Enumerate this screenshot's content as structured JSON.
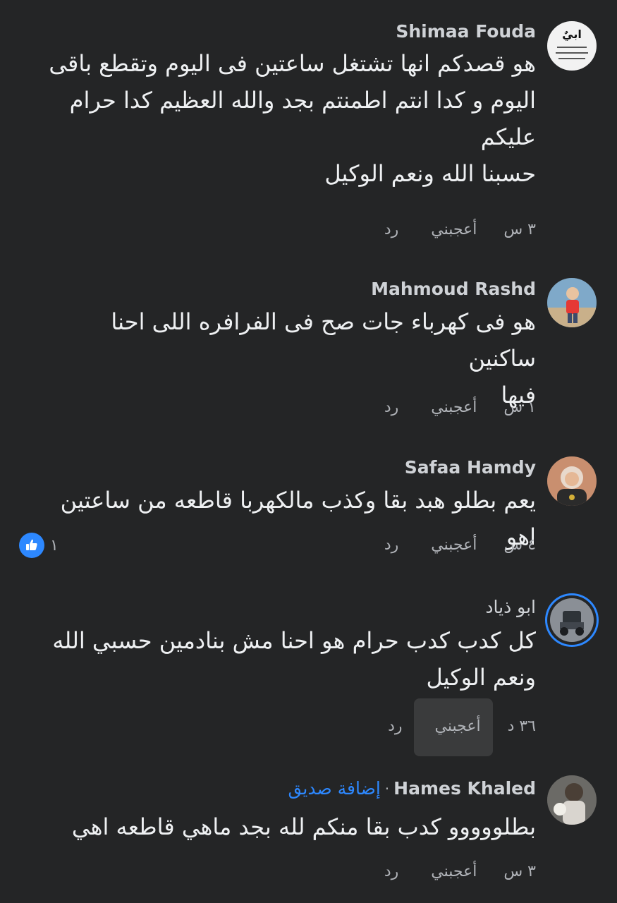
{
  "comments": [
    {
      "author": "Shimaa Fouda",
      "avatar_text": "ابيٌ",
      "lines": [
        "هو قصدكم انها تشتغل ساعتين فى اليوم وتقطع باقى",
        "اليوم و كدا انتم اطمنتم بجد والله العظيم كدا حرام",
        "عليكم",
        "حسبنا الله ونعم الوكيل"
      ],
      "time": "٣ س",
      "like": "أعجبني",
      "reply": "رد"
    },
    {
      "author": "Mahmoud Rashd",
      "lines": [
        "هو فى كهرباء جات صح فى الفرافره اللى احنا ساكنين",
        "فيها"
      ],
      "time": "١ س",
      "like": "أعجبني",
      "reply": "رد"
    },
    {
      "author": "Safaa Hamdy",
      "lines": [
        "يعم بطلو هبد بقا وكذب مالكهربا قاطعه من ساعتين اهو"
      ],
      "time": "٤ س",
      "like": "أعجبني",
      "reply": "رد",
      "reaction_count": "١"
    },
    {
      "author": "ابو ذياد",
      "lines": [
        "كل كدب كدب حرام هو احنا مش بنادمين حسبي الله",
        "ونعم الوكيل"
      ],
      "time": "٣٦ د",
      "like": "أعجبني",
      "reply": "رد"
    },
    {
      "author": "Hames Khaled",
      "separator": "·",
      "add_friend": "إضافة صديق",
      "lines": [
        "بطلووووو كدب بقا منكم لله بجد ماهي قاطعه اهي"
      ],
      "time": "٣ س",
      "like": "أعجبني",
      "reply": "رد"
    }
  ],
  "colors": {
    "background": "#242526",
    "text": "#e4e6eb",
    "secondary": "#b0b3b8",
    "accent": "#2d88ff"
  }
}
